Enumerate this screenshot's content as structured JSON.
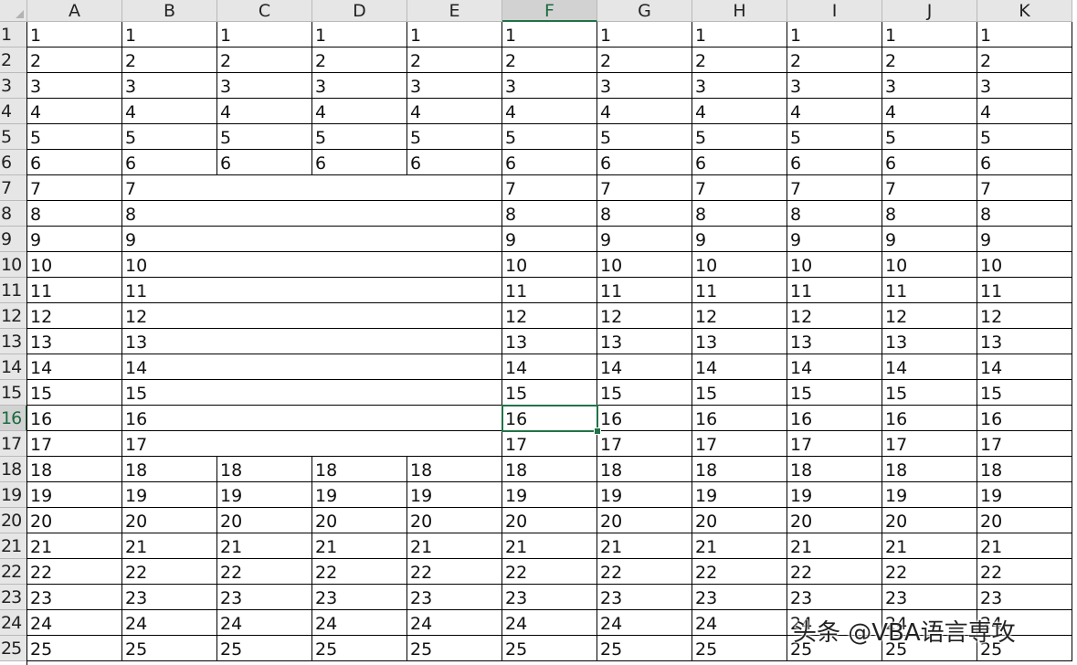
{
  "sheet": {
    "columns": [
      "A",
      "B",
      "C",
      "D",
      "E",
      "F",
      "G",
      "H",
      "I",
      "J",
      "K"
    ],
    "row_count": 25,
    "active_cell": {
      "col": "F",
      "row": 16
    },
    "merged_blocks": [
      {
        "from_row": 7,
        "to_row": 17,
        "from_col": "B",
        "to_col": "E"
      }
    ],
    "cell_values_by_row": [
      "1",
      "2",
      "3",
      "4",
      "5",
      "6",
      "7",
      "8",
      "9",
      "10",
      "11",
      "12",
      "13",
      "14",
      "15",
      "16",
      "17",
      "18",
      "19",
      "20",
      "21",
      "22",
      "23",
      "24",
      "25"
    ],
    "colors": {
      "header_bg": "#e6e6e6",
      "selected_header_bg": "#d2d2d2",
      "accent": "#217346",
      "grid_border": "#000000"
    }
  },
  "watermark": {
    "text": "头条 @VBA语言専攻"
  }
}
